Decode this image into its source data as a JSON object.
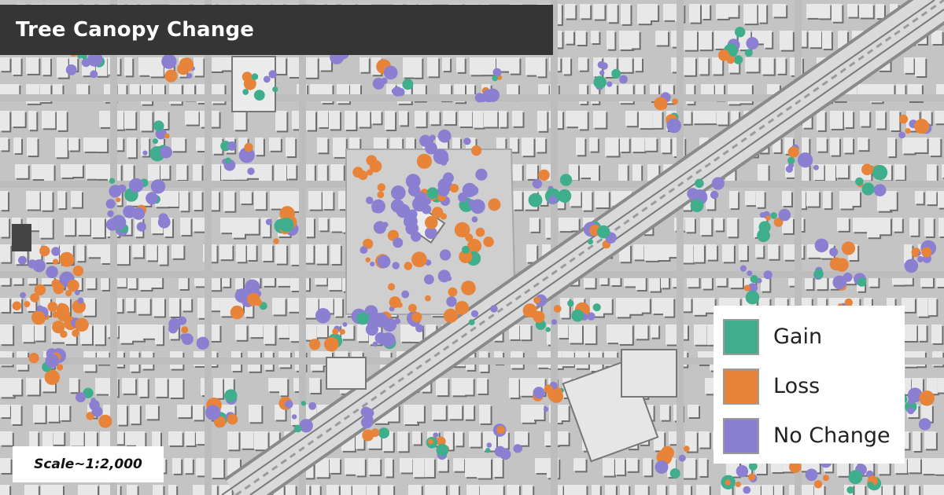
{
  "title": "Tree Canopy Change",
  "legend": {
    "items": [
      {
        "label": "Gain",
        "color": "#3fae8c"
      },
      {
        "label": "Loss",
        "color": "#e8843a"
      },
      {
        "label": "No Change",
        "color": "#8a7fd0"
      }
    ]
  },
  "scale": {
    "label": "Scale~1:2,000"
  },
  "map_style": {
    "base_color": "#c4c4c4",
    "building_color": "#e8e8e8",
    "shadow_color": "#6e6e6e",
    "rail_color": "#d8d8d8"
  }
}
